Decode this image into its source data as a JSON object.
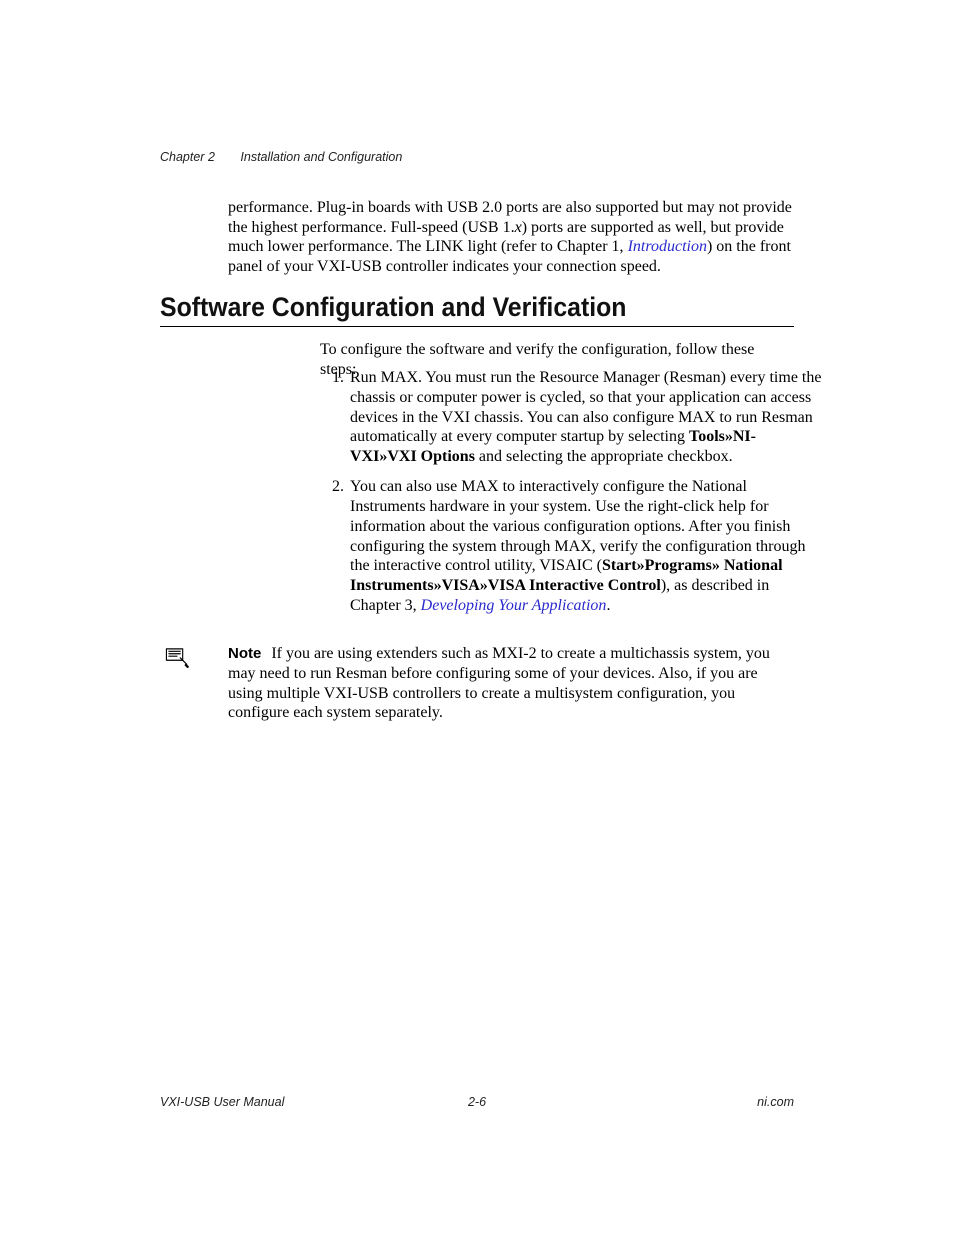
{
  "header": {
    "chapter_label": "Chapter 2",
    "chapter_title": "Installation and Configuration"
  },
  "intro": {
    "p1_a": "performance. Plug-in boards with USB 2.0 ports are also supported but may not provide the highest performance. Full-speed (USB 1.",
    "p1_x": "x",
    "p1_b": ") ports are supported as well, but provide much lower performance. The LINK light (refer to Chapter 1, ",
    "link": "Introduction",
    "p1_c": ") on the front panel of your VXI-USB controller indicates your connection speed."
  },
  "section_heading": "Software Configuration and Verification",
  "lead": "To configure the software and verify the configuration, follow these steps:",
  "steps": {
    "s1_a": "Run MAX. You must run the Resource Manager (Resman) every time the chassis or computer power is cycled, so that your application can access devices in the VXI chassis. You can also configure MAX to run Resman automatically at every computer startup by selecting ",
    "s1_bold": "Tools»NI-VXI»VXI Options",
    "s1_b": " and selecting the appropriate checkbox.",
    "s2_a": "You can also use MAX to interactively configure the National Instruments hardware in your system. Use the right-click help for information about the various configuration options. After you finish configuring the system through MAX, verify the configuration through the interactive control utility, VISAIC (",
    "s2_bold": "Start»Programs» National Instruments»VISA»VISA Interactive Control",
    "s2_b": "), as described in Chapter 3, ",
    "s2_link": "Developing Your Application",
    "s2_c": "."
  },
  "note": {
    "label": "Note",
    "text": "If you are using extenders such as MXI-2 to create a multichassis system, you may need to run Resman before configuring some of your devices. Also, if you are using multiple VXI-USB controllers to create a multisystem configuration, you configure each system separately."
  },
  "footer": {
    "manual": "VXI-USB User Manual",
    "page": "2-6",
    "site": "ni.com"
  }
}
